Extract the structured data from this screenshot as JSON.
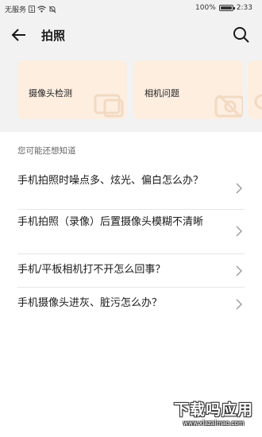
{
  "status_bar": {
    "carrier": "无服务",
    "sim_label": "1",
    "battery_percent": "100%",
    "battery_level": 1.0,
    "time": "2:33",
    "icons": [
      "sim-icon",
      "wifi-icon",
      "mute-icon",
      "battery-icon"
    ]
  },
  "header": {
    "title": "拍照",
    "back_icon": "arrow-left-icon",
    "search_icon": "search-icon"
  },
  "cards": [
    {
      "label": "摄像头检测",
      "icon": "camera-outline-icon"
    },
    {
      "label": "相机问题",
      "icon": "camera-off-icon"
    },
    {
      "label": "",
      "icon": "card-partial"
    }
  ],
  "faq": {
    "section_title": "您可能还想知道",
    "items": [
      "手机拍照时噪点多、炫光、偏白怎么办？",
      "手机拍照（录像）后置摄像头模糊不清晰",
      "手机/平板相机打不开怎么回事？",
      "手机摄像头进灰、脏污怎么办？"
    ]
  },
  "watermark": {
    "main": "下载吗应用",
    "sub": "www.xiazaimao.com"
  },
  "colors": {
    "page_bg": "#f2f2f2",
    "card_bg": "#fdeee0",
    "panel_bg": "#ffffff",
    "divider": "#e6e6e6",
    "secondary_text": "#666666"
  }
}
